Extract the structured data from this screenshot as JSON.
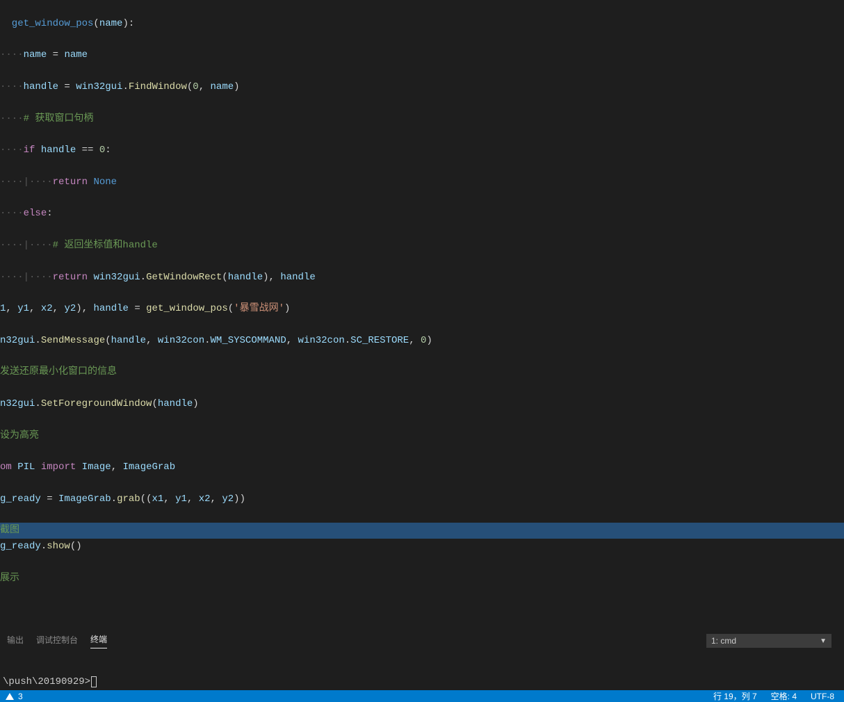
{
  "code": {
    "l0_a": "  get_window_pos",
    "l0_b": "(",
    "l0_c": "name",
    "l0_d": "):",
    "l1_dots": "····",
    "l1_a": "name",
    "l1_eq": " = ",
    "l1_b": "name",
    "l2_dots": "····",
    "l2_a": "handle",
    "l2_eq": " = ",
    "l2_b": "win32gui",
    "l2_c": ".",
    "l2_d": "FindWindow",
    "l2_e": "(",
    "l2_f": "0",
    "l2_g": ", ",
    "l2_h": "name",
    "l2_i": ")",
    "l3_dots": "····",
    "l3_txt": "# 获取窗口句柄",
    "l4_dots": "····",
    "l4_if": "if",
    "l4_sp": " ",
    "l4_a": "handle",
    "l4_eq": " == ",
    "l4_b": "0",
    "l4_c": ":",
    "l5_dots": "····",
    "l5_bar": "|",
    "l5_dots2": "····",
    "l5_ret": "return",
    "l5_sp": " ",
    "l5_none": "None",
    "l6_dots": "····",
    "l6_else": "else",
    "l6_c": ":",
    "l7_dots": "····",
    "l7_bar": "|",
    "l7_dots2": "····",
    "l7_txt": "# 返回坐标值和handle",
    "l8_dots": "····",
    "l8_bar": "|",
    "l8_dots2": "····",
    "l8_ret": "return",
    "l8_sp": " ",
    "l8_a": "win32gui",
    "l8_b": ".",
    "l8_c": "GetWindowRect",
    "l8_d": "(",
    "l8_e": "handle",
    "l8_f": "), ",
    "l8_g": "handle",
    "l9_a": "1",
    "l9_b": ", ",
    "l9_c": "y1",
    "l9_d": ", ",
    "l9_e": "x2",
    "l9_f": ", ",
    "l9_g": "y2",
    "l9_h": ")",
    "l9_i": ", ",
    "l9_j": "handle",
    "l9_k": " = ",
    "l9_l": "get_window_pos",
    "l9_m": "(",
    "l9_n": "'暴雪战网'",
    "l9_o": ")",
    "l10_a": "n32gui",
    "l10_b": ".",
    "l10_c": "SendMessage",
    "l10_d": "(",
    "l10_e": "handle",
    "l10_f": ", ",
    "l10_g": "win32con",
    "l10_h": ".",
    "l10_i": "WM_SYSCOMMAND",
    "l10_j": ", ",
    "l10_k": "win32con",
    "l10_l": ".",
    "l10_m": "SC_RESTORE",
    "l10_n": ", ",
    "l10_o": "0",
    "l10_p": ")",
    "l11_txt": "发送还原最小化窗口的信息",
    "l12_a": "n32gui",
    "l12_b": ".",
    "l12_c": "SetForegroundWindow",
    "l12_d": "(",
    "l12_e": "handle",
    "l12_f": ")",
    "l13_txt": "设为高亮",
    "l14_a": "om",
    "l14_sp": " ",
    "l14_b": "PIL",
    "l14_sp2": " ",
    "l14_c": "import",
    "l14_sp3": " ",
    "l14_d": "Image",
    "l14_e": ", ",
    "l14_f": "ImageGrab",
    "l15_a": "g_ready",
    "l15_b": " = ",
    "l15_c": "ImageGrab",
    "l15_d": ".",
    "l15_e": "grab",
    "l15_f": "((",
    "l15_g": "x1",
    "l15_h": ", ",
    "l15_i": "y1",
    "l15_j": ", ",
    "l15_k": "x2",
    "l15_l": ", ",
    "l15_m": "y2",
    "l15_n": "))",
    "l16_txt": "截图",
    "l17_a": "g_ready",
    "l17_b": ".",
    "l17_c": "show",
    "l17_d": "()",
    "l18_txt": "展示"
  },
  "panel": {
    "tab_output": "输出",
    "tab_debug": "调试控制台",
    "tab_terminal": "终端",
    "select_label": "1: cmd"
  },
  "terminal": {
    "prompt": "\\push\\20190929>"
  },
  "status": {
    "warnings": "3",
    "line_col": "行 19，列 7",
    "spaces": "空格: 4",
    "encoding": "UTF-8"
  }
}
